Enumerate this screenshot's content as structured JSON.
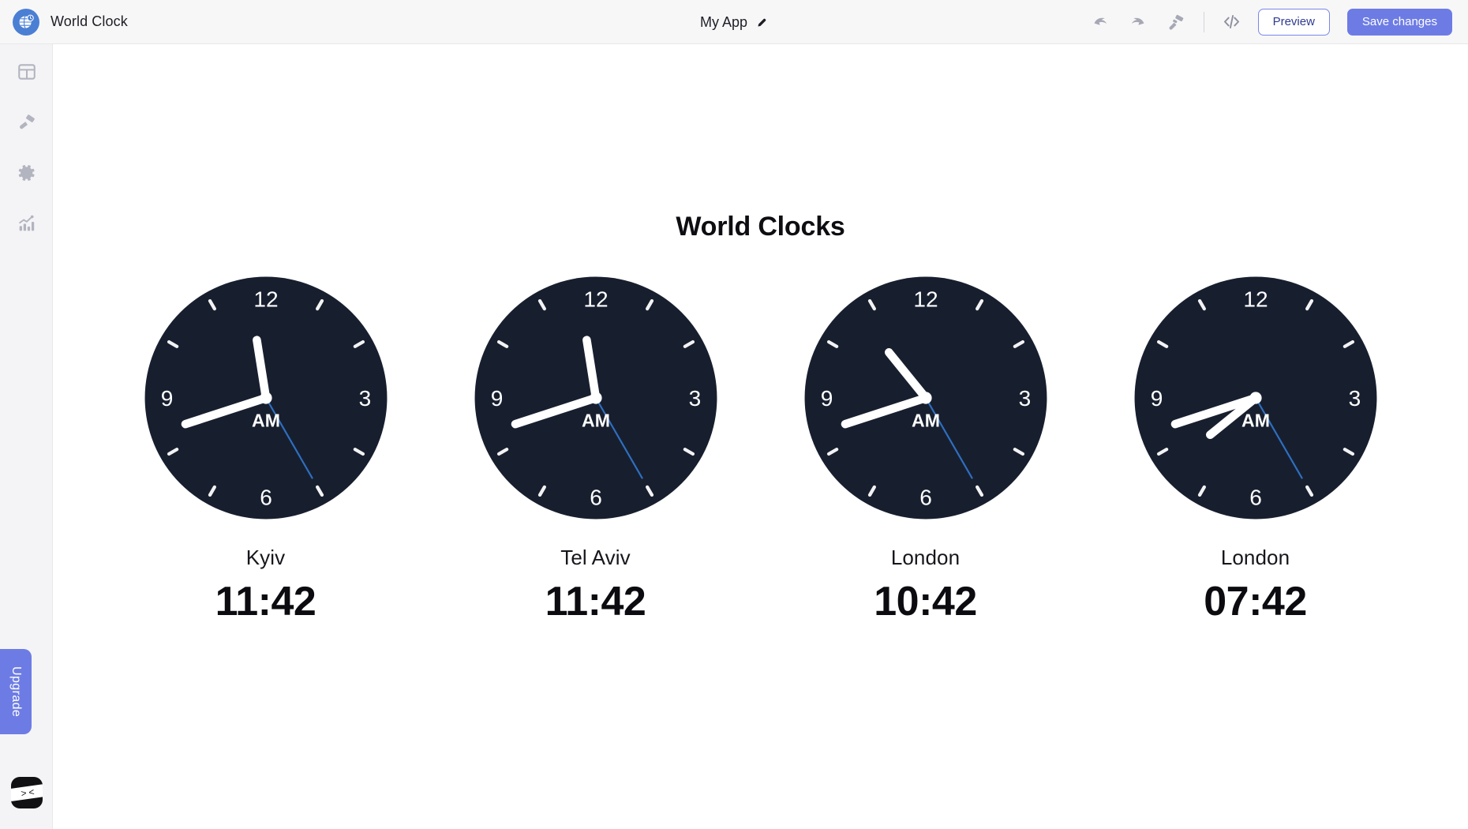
{
  "topbar": {
    "brand_name": "World Clock",
    "logo_icon": "globe-clock-logo",
    "app_title": "My App",
    "edit_icon": "pencil-icon",
    "undo_icon": "undo-arrow-icon",
    "redo_icon": "redo-arrow-icon",
    "theme_icon": "paint-roller-icon",
    "code_icon": "code-brackets-icon",
    "preview_label": "Preview",
    "save_label": "Save changes",
    "accent_color": "#6d7ce4",
    "bar_color": "#f7f7f8"
  },
  "sidebar": {
    "items": [
      {
        "icon": "layout-grid-icon",
        "name": "layout"
      },
      {
        "icon": "paint-brush-icon",
        "name": "theme"
      },
      {
        "icon": "gear-icon",
        "name": "settings"
      },
      {
        "icon": "analytics-chart-icon",
        "name": "analytics"
      }
    ],
    "upgrade_label": "Upgrade",
    "mascot_icon": "ninja-mascot-icon",
    "mascot_eyes": [
      ">",
      "<"
    ],
    "rail_color": "#f4f4f6"
  },
  "canvas": {
    "heading": "World Clocks",
    "face_color": "#171f2f",
    "hand_color": "#ffffff",
    "second_hand_color": "#2f6fc0",
    "numerals": [
      "12",
      "3",
      "6",
      "9"
    ],
    "clocks": [
      {
        "city": "Kyiv",
        "time": "11:42",
        "meridiem": "AM",
        "hour_deg": 351,
        "minute_deg": 252,
        "second_deg": 150
      },
      {
        "city": "Tel Aviv",
        "time": "11:42",
        "meridiem": "AM",
        "hour_deg": 351,
        "minute_deg": 252,
        "second_deg": 150
      },
      {
        "city": "London",
        "time": "10:42",
        "meridiem": "AM",
        "hour_deg": 321,
        "minute_deg": 252,
        "second_deg": 150
      },
      {
        "city": "London",
        "time": "07:42",
        "meridiem": "AM",
        "hour_deg": 231,
        "minute_deg": 252,
        "second_deg": 150
      }
    ]
  }
}
